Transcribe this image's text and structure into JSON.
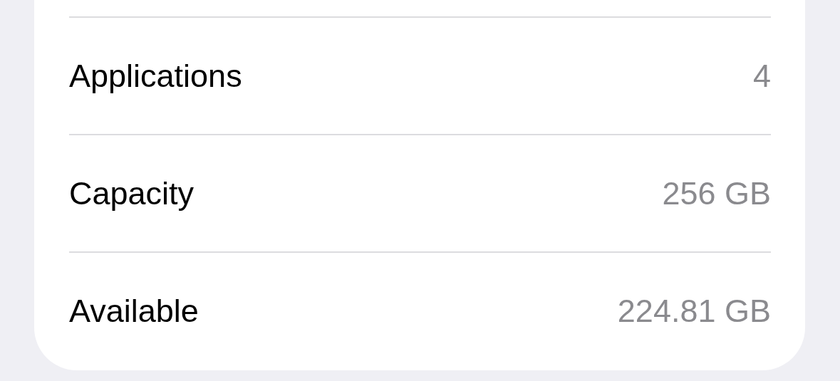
{
  "rows": [
    {
      "label": "Applications",
      "value": "4"
    },
    {
      "label": "Capacity",
      "value": "256 GB"
    },
    {
      "label": "Available",
      "value": "224.81 GB"
    }
  ]
}
